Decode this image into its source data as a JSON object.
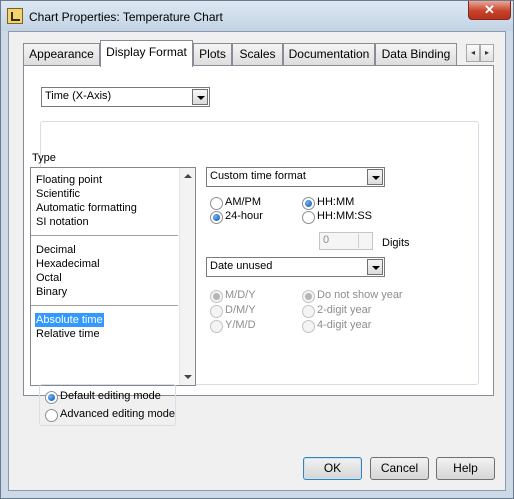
{
  "window": {
    "title": "Chart Properties: Temperature Chart",
    "close_label": "✕"
  },
  "tabs": [
    "Appearance",
    "Display Format",
    "Plots",
    "Scales",
    "Documentation",
    "Data Binding"
  ],
  "tab_scroll": {
    "left": "◂",
    "right": "▸"
  },
  "axis_select": {
    "value": "Time (X-Axis)"
  },
  "type_section": {
    "label": "Type",
    "groups": [
      [
        "Floating point",
        "Scientific",
        "Automatic formatting",
        "SI notation"
      ],
      [
        "Decimal",
        "Hexadecimal",
        "Octal",
        "Binary"
      ],
      [
        "Absolute time",
        "Relative time"
      ]
    ],
    "selected": "Absolute time"
  },
  "time_format": {
    "format_select": "Custom time format",
    "radios": {
      "ampm": "AM/PM",
      "hour24": "24-hour",
      "hhmm": "HH:MM",
      "hhmmss": "HH:MM:SS"
    },
    "selected_clock": "24-hour",
    "selected_time": "HH:MM",
    "digits_value": "0",
    "digits_label": "Digits",
    "date_select": "Date unused",
    "date_order": [
      "M/D/Y",
      "D/M/Y",
      "Y/M/D"
    ],
    "year_options": [
      "Do not show year",
      "2-digit year",
      "4-digit year"
    ]
  },
  "editing_mode": {
    "default": "Default editing mode",
    "advanced": "Advanced editing mode",
    "selected": "default"
  },
  "buttons": {
    "ok": "OK",
    "cancel": "Cancel",
    "help": "Help"
  }
}
